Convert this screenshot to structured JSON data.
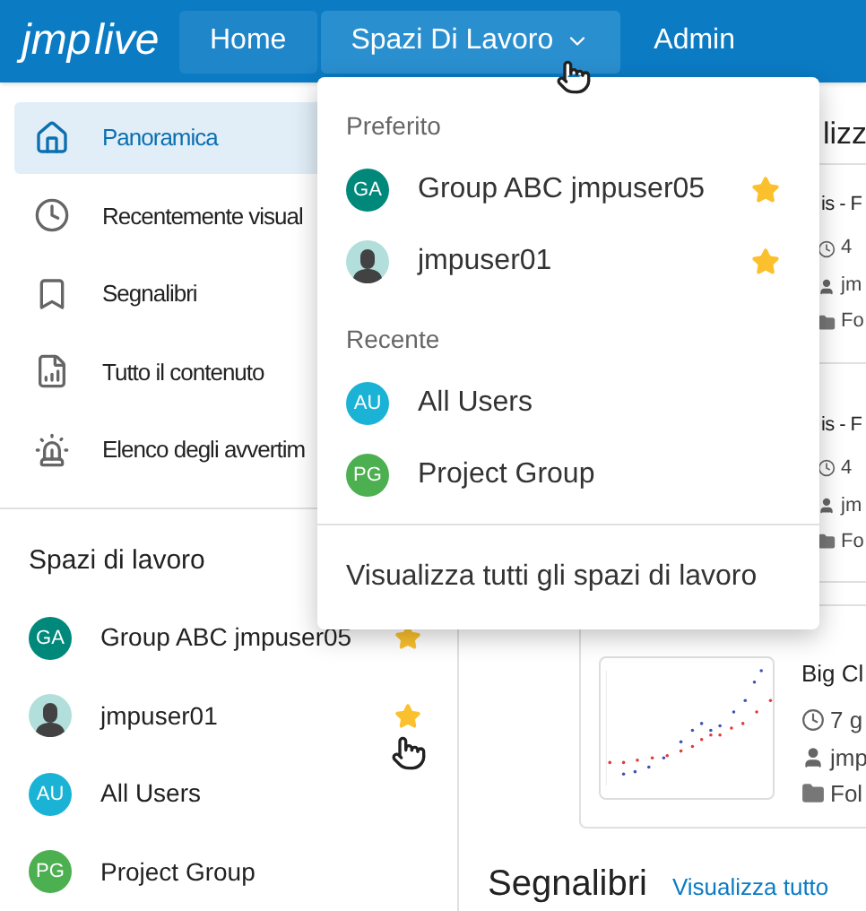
{
  "nav": {
    "logo": {
      "part_1": "jmp",
      "part_2": "live"
    },
    "items": [
      {
        "label": "Home",
        "selected": true,
        "open": false,
        "has_menu": false
      },
      {
        "label": "Spazi Di Lavoro",
        "selected": false,
        "open": true,
        "has_menu": true
      },
      {
        "label": "Admin",
        "selected": false,
        "open": false,
        "has_menu": false
      }
    ]
  },
  "sidebar": {
    "items": [
      {
        "label": "Panoramica",
        "selected": true
      },
      {
        "label": "Recentemente visual",
        "selected": false
      },
      {
        "label": "Segnalibri",
        "selected": false
      },
      {
        "label": "Tutto il contenuto",
        "selected": false
      },
      {
        "label": "Elenco degli avvertim",
        "selected": false
      }
    ],
    "workspaces_heading": "Spazi di lavoro",
    "workspaces": [
      {
        "kind": "initials",
        "initials": "GA",
        "name": "Group ABC jmpuser05",
        "color": "#00897b",
        "favorite": true
      },
      {
        "kind": "photo",
        "name": "jmpuser01",
        "favorite": true
      },
      {
        "kind": "initials",
        "initials": "AU",
        "name": "All Users",
        "color": "#1ab3d6",
        "favorite": false
      },
      {
        "kind": "initials",
        "initials": "PG",
        "name": "Project Group",
        "color": "#4caf50",
        "favorite": false
      }
    ]
  },
  "dropdown": {
    "sections": [
      {
        "heading": "Preferito",
        "items": [
          {
            "kind": "initials",
            "initials": "GA",
            "name": "Group ABC jmpuser05",
            "color": "#00897b",
            "favorite": true
          },
          {
            "kind": "photo",
            "name": "jmpuser01",
            "favorite": true
          }
        ]
      },
      {
        "heading": "Recente",
        "items": [
          {
            "kind": "initials",
            "initials": "AU",
            "name": "All Users",
            "color": "#1ab3d6",
            "favorite": false
          },
          {
            "kind": "initials",
            "initials": "PG",
            "name": "Project Group",
            "color": "#4caf50",
            "favorite": false
          }
        ]
      }
    ],
    "footer_link": "Visualizza tutti gli spazi di lavoro"
  },
  "main": {
    "heading": "lizz",
    "cards": [
      {
        "title": "is - F",
        "time": "4",
        "owner": "jm",
        "folder": "Fo",
        "thumbnail": false
      },
      {
        "title": "is - F",
        "time": "4",
        "owner": "jm",
        "folder": "Fo",
        "thumbnail": false
      },
      {
        "title": "Big Cl",
        "time": "7 g",
        "owner": "jmp",
        "folder": "Fol",
        "thumbnail": true
      }
    ],
    "bookmarks": {
      "title": "Segnalibri",
      "link": "Visualizza tutto"
    }
  }
}
